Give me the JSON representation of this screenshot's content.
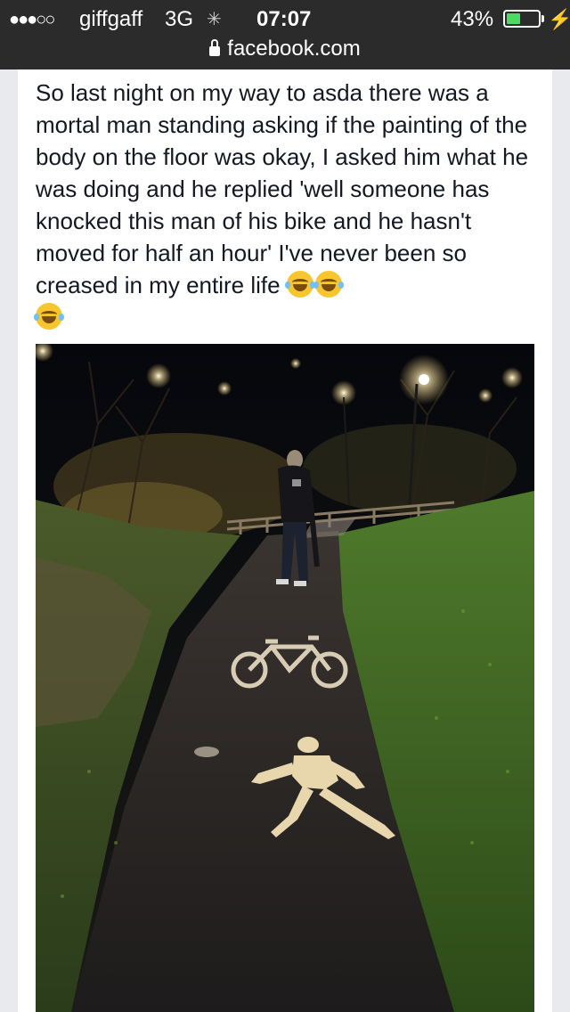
{
  "status_bar": {
    "signal": "●●●○○",
    "carrier": "giffgaff",
    "network": "3G",
    "activity_icon": "spinner-icon",
    "time": "07:07",
    "battery_percent": "43%",
    "battery_level": 0.43,
    "charging_icon": "bolt-icon"
  },
  "address_bar": {
    "lock_icon": "lock-icon",
    "url": "facebook.com"
  },
  "post": {
    "text": "So last night on my way to asda there was a mortal man standing asking if the painting of the body on the floor was okay, I asked him what he was doing and he replied 'well someone has knocked this man of his bike and he hasn't moved for half an hour' I've never been so creased in my entire life",
    "emojis": [
      "tears-of-joy-emoji",
      "tears-of-joy-emoji",
      "tears-of-joy-emoji"
    ]
  },
  "colors": {
    "status_bar_bg": "#2b2b2b",
    "battery_fill": "#4cd964",
    "page_bg": "#e9eaed",
    "post_text": "#141823"
  }
}
